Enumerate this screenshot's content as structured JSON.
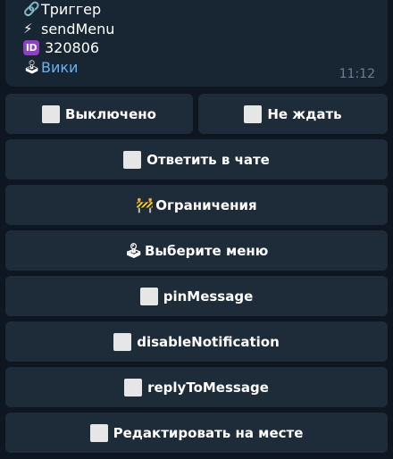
{
  "message": {
    "lines": [
      {
        "icon": "🔗",
        "text": "Триггер"
      },
      {
        "icon": "⚡",
        "text": "sendMenu"
      },
      {
        "icon": "ID",
        "text": "320806"
      },
      {
        "icon": "🕹",
        "text": "Вики"
      }
    ],
    "time": "11:12"
  },
  "keyboard": {
    "row1": {
      "left": {
        "icon": "checkbox-unchecked",
        "label": "Выключено"
      },
      "right": {
        "icon": "checkbox-unchecked",
        "label": "Не ждать"
      }
    },
    "buttons": [
      {
        "icon": "checkbox-unchecked",
        "label": "Ответить в чате"
      },
      {
        "icon": "🚧",
        "label": "Ограничения"
      },
      {
        "icon": "🕹",
        "label": "Выберите меню"
      },
      {
        "icon": "checkbox-unchecked",
        "label": "pinMessage"
      },
      {
        "icon": "checkbox-unchecked",
        "label": "disableNotification"
      },
      {
        "icon": "checkbox-unchecked",
        "label": "replyToMessage"
      },
      {
        "icon": "checkbox-unchecked",
        "label": "Редактировать на месте"
      }
    ]
  },
  "colors": {
    "background": "#0e1621",
    "bubble": "#182533",
    "button": "#1e2c3a",
    "link": "#6ab2f2",
    "time": "#6d7f8f",
    "id_badge": "#8e3ec7"
  }
}
